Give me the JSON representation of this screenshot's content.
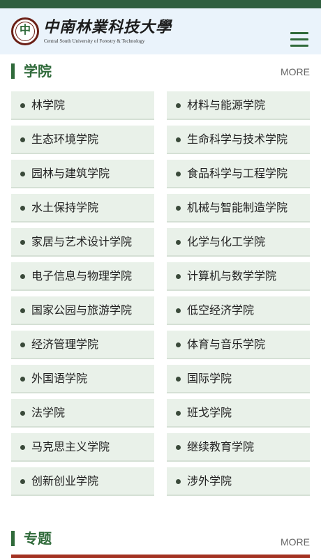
{
  "header": {
    "logo_glyph": "中",
    "logo_cn": "中南林業科技大學",
    "logo_en": "Central South University of Forestry & Technology"
  },
  "colleges": {
    "title": "学院",
    "more": "MORE",
    "items": [
      {
        "label": "林学院"
      },
      {
        "label": "材料与能源学院"
      },
      {
        "label": "生态环境学院"
      },
      {
        "label": "生命科学与技术学院"
      },
      {
        "label": "园林与建筑学院"
      },
      {
        "label": "食品科学与工程学院"
      },
      {
        "label": "水土保持学院"
      },
      {
        "label": "机械与智能制造学院"
      },
      {
        "label": "家居与艺术设计学院"
      },
      {
        "label": "化学与化工学院"
      },
      {
        "label": "电子信息与物理学院"
      },
      {
        "label": "计算机与数学学院"
      },
      {
        "label": "国家公园与旅游学院"
      },
      {
        "label": "低空经济学院"
      },
      {
        "label": "经济管理学院"
      },
      {
        "label": "体育与音乐学院"
      },
      {
        "label": "外国语学院"
      },
      {
        "label": "国际学院"
      },
      {
        "label": "法学院"
      },
      {
        "label": "班戈学院"
      },
      {
        "label": "马克思主义学院"
      },
      {
        "label": "继续教育学院"
      },
      {
        "label": "创新创业学院"
      },
      {
        "label": "涉外学院"
      }
    ]
  },
  "topics": {
    "title": "专题",
    "more": "MORE"
  },
  "colors": {
    "brand_green": "#2f6a3a",
    "cell_bg": "#e9f1e9",
    "header_bg": "#eaf3fb",
    "accent_red": "#a33222"
  }
}
